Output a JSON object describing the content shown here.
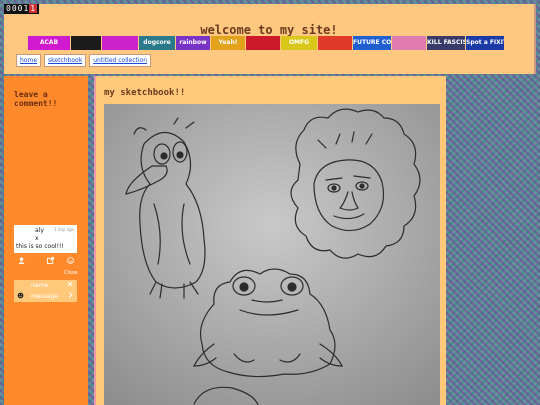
{
  "hit_counter": {
    "digits": "0001",
    "last": "1"
  },
  "header": {
    "title": "welcome to my site!",
    "buttons": [
      {
        "label": "ACAB",
        "color": "#d01ad0",
        "width": 42
      },
      {
        "label": "",
        "color": "#1b1b1b",
        "width": 30
      },
      {
        "label": "",
        "color": "#cc22cc",
        "width": 36
      },
      {
        "label": "dogcore",
        "color": "#2a7a8c",
        "width": 36
      },
      {
        "label": "rainbow",
        "color": "#7a33c7",
        "width": 34
      },
      {
        "label": "Yeah!",
        "color": "#e3a21b",
        "width": 34
      },
      {
        "label": "",
        "color": "#cc1a2a",
        "width": 34
      },
      {
        "label": "OMFG",
        "color": "#d9c81a",
        "width": 36
      },
      {
        "label": "",
        "color": "#e23a2a",
        "width": 34
      },
      {
        "label": "FUTURE CORPS",
        "color": "#1f5fd0",
        "width": 38
      },
      {
        "label": "",
        "color": "#e07ab0",
        "width": 34
      },
      {
        "label": "KILL FASCISTS",
        "color": "#3a3a6a",
        "width": 38
      },
      {
        "label": "Spot a FIXIT call",
        "color": "#1a3aa8",
        "width": 38
      }
    ],
    "nav": [
      "home",
      "sketchbook",
      "untitled collection"
    ]
  },
  "sidebar": {
    "title": "leave a comment!!",
    "comment": {
      "name": "aly",
      "time": "1 day ago",
      "x": "x",
      "text": "this is so cool!!!"
    },
    "tools": {
      "user_icon": "user-icon",
      "link_icon": "external-link-icon",
      "smile_icon": "smile-icon"
    },
    "close_label": "Close",
    "form": {
      "name_placeholder": "name",
      "message_placeholder": "message"
    }
  },
  "main": {
    "title": "my sketchbook!!",
    "photo_alt": ""
  }
}
